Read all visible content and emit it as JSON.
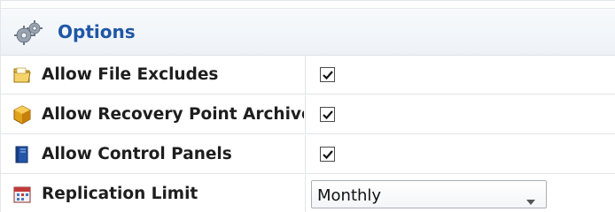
{
  "options": {
    "title": "Options",
    "header_icon": "gears-icon",
    "rows": [
      {
        "label": "Allow File Excludes",
        "icon": "folder-icon",
        "checked": true
      },
      {
        "label": "Allow Recovery Point Archive",
        "icon": "cube-icon",
        "checked": true
      },
      {
        "label": "Allow Control Panels",
        "icon": "book-icon",
        "checked": true
      }
    ],
    "replication": {
      "label": "Replication Limit",
      "icon": "calendar-icon",
      "selected": "Monthly"
    }
  },
  "colors": {
    "title": "#1f57a6",
    "border": "#e2e5e9"
  }
}
